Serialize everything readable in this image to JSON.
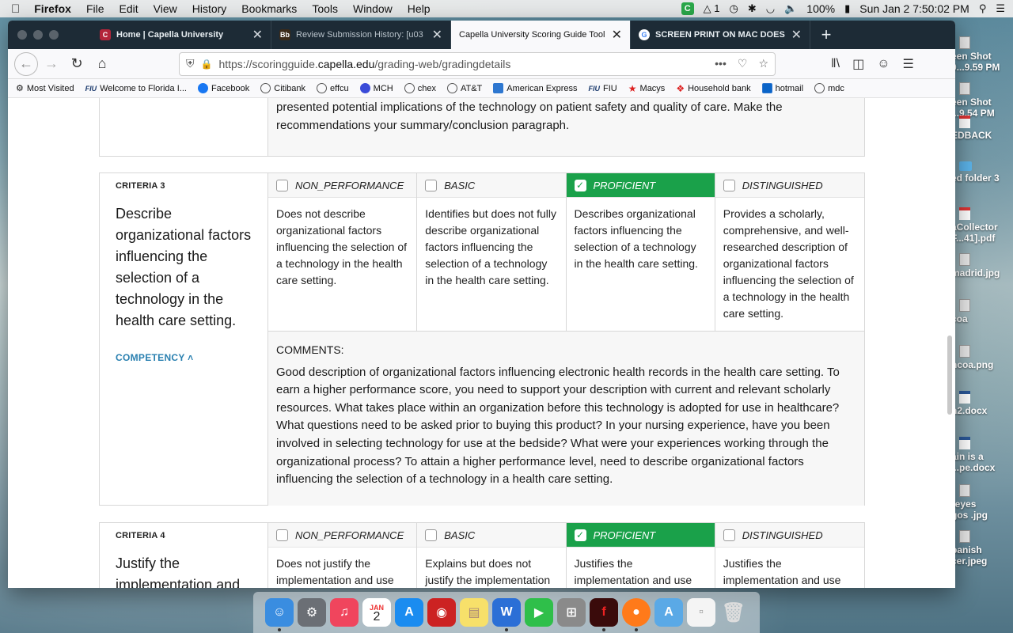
{
  "menubar": {
    "app": "Firefox",
    "items": [
      "File",
      "Edit",
      "View",
      "History",
      "Bookmarks",
      "Tools",
      "Window",
      "Help"
    ],
    "status": {
      "badge": "C",
      "adobe": "1",
      "battery": "100%",
      "datetime": "Sun Jan 2  7:50:02 PM"
    }
  },
  "desktop": {
    "items": [
      {
        "label": "een Shot\n0...9.59 PM",
        "type": "img"
      },
      {
        "label": "een Shot\n...9.54 PM",
        "type": "img"
      },
      {
        "label": "EDBACK",
        "type": "pdf"
      },
      {
        "label": "ed folder 3",
        "type": "folder"
      },
      {
        "label": "aCollector\nF...41].pdf",
        "type": "pdf"
      },
      {
        "label": "madrid.jpg",
        "type": "img"
      },
      {
        "label": "coa",
        "type": "img"
      },
      {
        "label": "ncoa.png",
        "type": "img"
      },
      {
        "label": "n2.docx",
        "type": "doc"
      },
      {
        "label": "ain is a\n...pe.docx",
        "type": "doc"
      },
      {
        "label": "reyes\ngos .jpg",
        "type": "img"
      },
      {
        "label": "panish\ncer.jpeg",
        "type": "img"
      }
    ]
  },
  "browser": {
    "tabs": [
      {
        "label": "Home | Capella University",
        "active": false,
        "fav": "C",
        "favColor": "#b3253a"
      },
      {
        "label": "Review Submission History: [u03",
        "active": false,
        "fav": "Bb",
        "favColor": "#3b2a18"
      },
      {
        "label": "Capella University Scoring Guide Tool",
        "active": true,
        "fav": "",
        "favColor": "#f9f9fb"
      },
      {
        "label": "SCREEN PRINT ON MAC DOES",
        "active": false,
        "fav": "G",
        "favColor": "#ffffff"
      }
    ],
    "url": {
      "prefix": "https://scoringguide.",
      "host": "capella.edu",
      "path": "/grading-web/gradingdetails"
    },
    "bookmarks": [
      {
        "label": "Most Visited",
        "icon": "gear-icon"
      },
      {
        "label": "Welcome to Florida I...",
        "icon": "fiu-logo"
      },
      {
        "label": "Facebook",
        "icon": "facebook-icon"
      },
      {
        "label": "Citibank",
        "icon": "globe-icon"
      },
      {
        "label": "effcu",
        "icon": "globe-icon"
      },
      {
        "label": "MCH",
        "icon": "mch-icon"
      },
      {
        "label": "chex",
        "icon": "globe-icon"
      },
      {
        "label": "AT&T",
        "icon": "globe-icon"
      },
      {
        "label": "American Express",
        "icon": "amex-icon"
      },
      {
        "label": "FIU",
        "icon": "fiu-logo"
      },
      {
        "label": "Macys",
        "icon": "star-icon"
      },
      {
        "label": "Household bank",
        "icon": "hsbc-icon"
      },
      {
        "label": "hotmail",
        "icon": "outlook-icon"
      },
      {
        "label": "mdc",
        "icon": "globe-icon"
      }
    ]
  },
  "page": {
    "prev_text": "presented potential implications of the technology on patient safety and quality of care. Make the recommendations your summary/conclusion paragraph.",
    "criteria3": {
      "label": "CRITERIA 3",
      "title": "Describe organizational factors influencing the selection of a technology in the health care setting.",
      "competency": "COMPETENCY",
      "levels": [
        {
          "name": "NON_PERFORMANCE",
          "selected": false,
          "desc": "Does not describe organizational factors influencing the selection of a technology in the health care setting."
        },
        {
          "name": "BASIC",
          "selected": false,
          "desc": "Identifies but does not fully describe organizational factors influencing the selection of a technology in the health care setting."
        },
        {
          "name": "PROFICIENT",
          "selected": true,
          "desc": "Describes organizational factors influencing the selection of a technology in the health care setting."
        },
        {
          "name": "DISTINGUISHED",
          "selected": false,
          "desc": "Provides a scholarly, comprehensive, and well-researched description of organizational factors influencing the selection of a technology in the health care setting."
        }
      ],
      "comments_head": "COMMENTS:",
      "comments": "Good description of organizational factors influencing electronic health records in the health care setting. To earn a higher performance score, you need to support your description with current and relevant scholarly resources. What takes place within an organization before this technology is adopted for use in healthcare? What questions need to be asked prior to buying this product? In your nursing experience, have you been involved in selecting technology for use at the bedside? What were your experiences working through the organizational process? To attain a higher performance level, need to describe organizational factors influencing the selection of a technology in a health care setting."
    },
    "criteria4": {
      "label": "CRITERIA 4",
      "title": "Justify the implementation and",
      "levels": [
        {
          "name": "NON_PERFORMANCE",
          "selected": false,
          "desc": "Does not justify the implementation and use"
        },
        {
          "name": "BASIC",
          "selected": false,
          "desc": "Explains but does not justify the implementation"
        },
        {
          "name": "PROFICIENT",
          "selected": true,
          "desc": "Justifies the implementation and use"
        },
        {
          "name": "DISTINGUISHED",
          "selected": false,
          "desc": "Justifies the implementation and use"
        }
      ]
    }
  },
  "dock": {
    "date_badge_month": "JAN",
    "date_badge_day": "2"
  },
  "colors": {
    "proficient": "#1aa14a",
    "competency": "#2a80b0",
    "tabbar": "#1d2b36"
  }
}
